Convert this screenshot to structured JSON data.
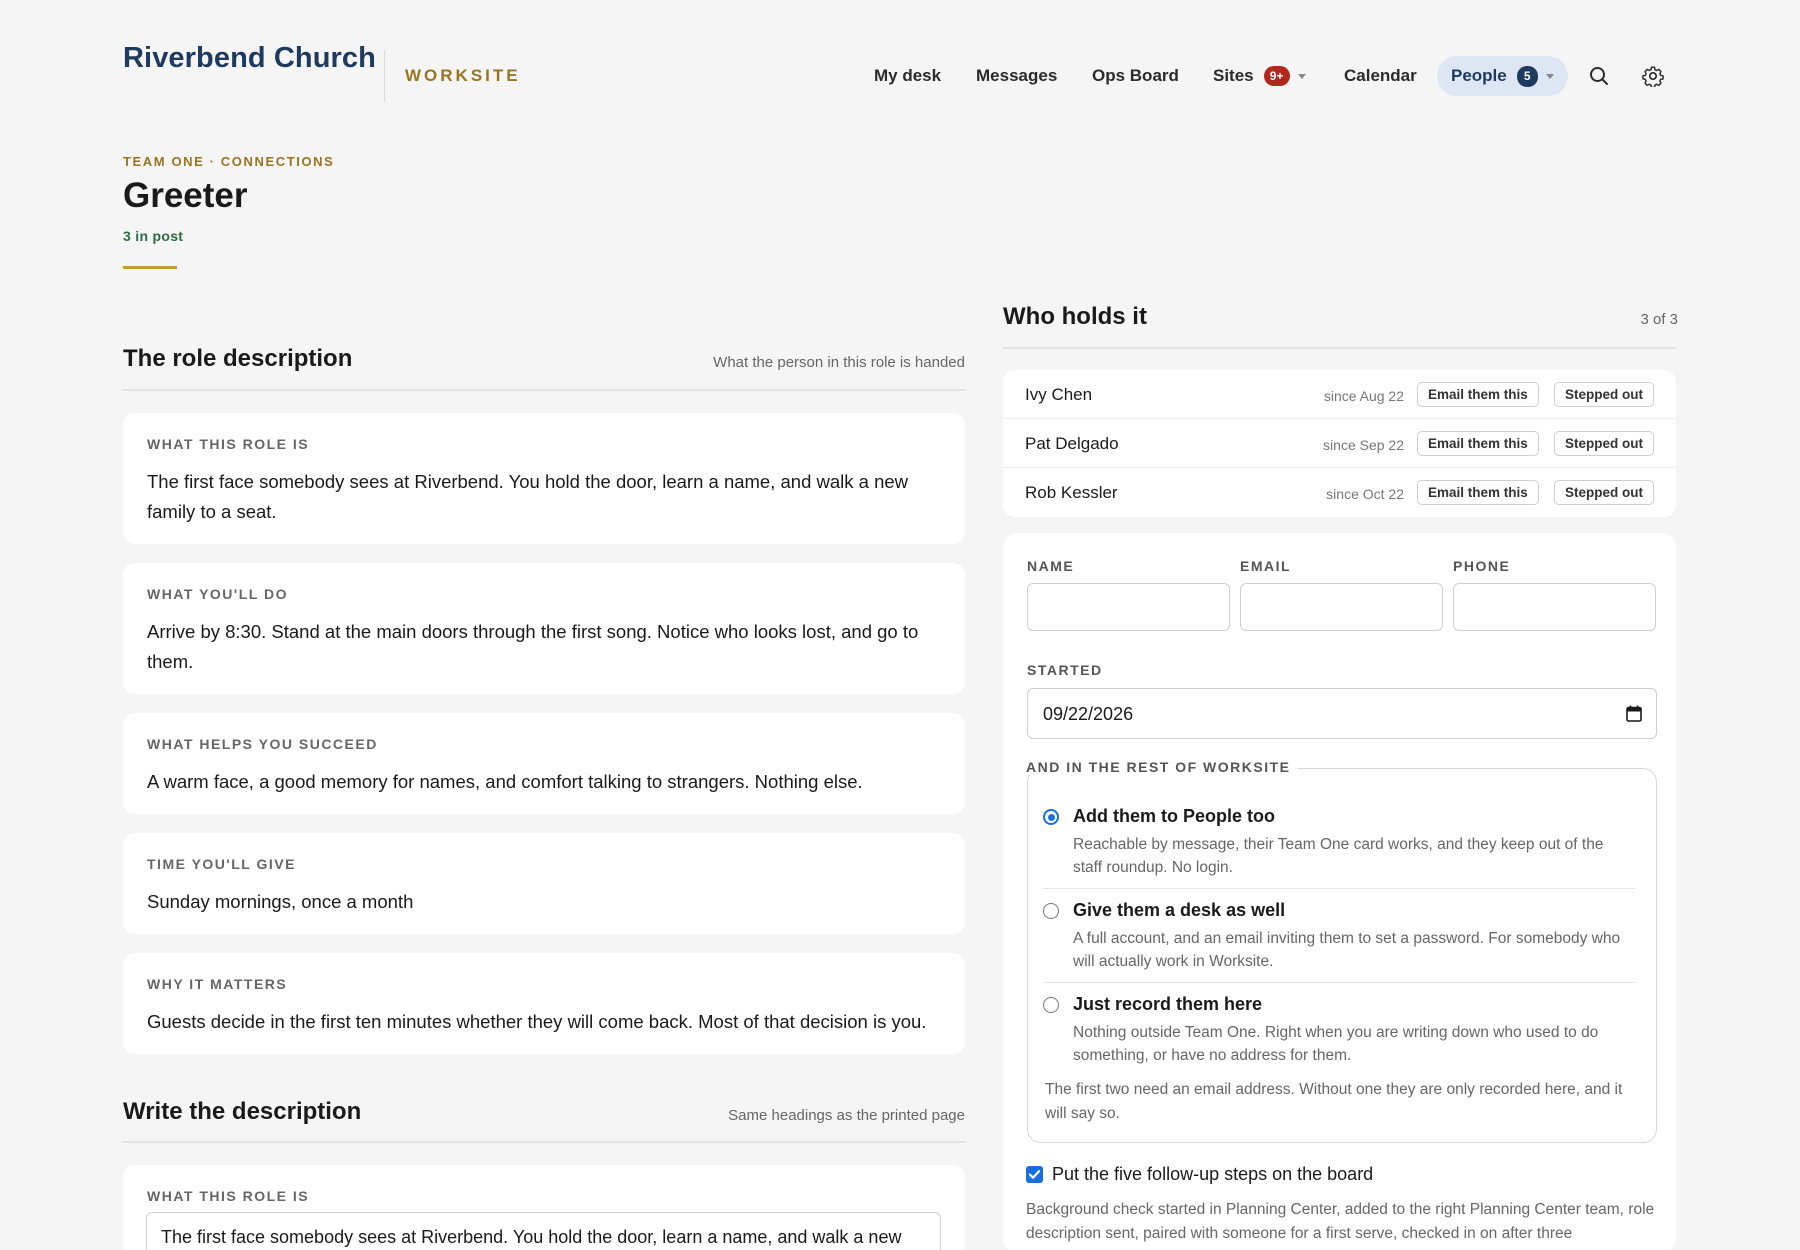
{
  "header": {
    "brand": "Riverbend Church",
    "product": "WORKSITE",
    "nav": [
      {
        "label": "My desk"
      },
      {
        "label": "Messages"
      },
      {
        "label": "Ops Board"
      },
      {
        "label": "Sites",
        "badge": "9+"
      },
      {
        "label": "Calendar"
      },
      {
        "label": "People",
        "badge": "5",
        "active": true
      }
    ],
    "icons": [
      "search-icon",
      "gear-icon"
    ]
  },
  "page": {
    "eyebrow": "TEAM ONE · CONNECTIONS",
    "title": "Greeter",
    "subtitle": "3 in post"
  },
  "role_description": {
    "title": "The role description",
    "note": "What the person in this role is handed",
    "sections": [
      {
        "label": "WHAT THIS ROLE IS",
        "text": "The first face somebody sees at Riverbend. You hold the door, learn a name, and walk a new family to a seat."
      },
      {
        "label": "WHAT YOU'LL DO",
        "text": "Arrive by 8:30. Stand at the main doors through the first song. Notice who looks lost, and go to them."
      },
      {
        "label": "WHAT HELPS YOU SUCCEED",
        "text": "A warm face, a good memory for names, and comfort talking to strangers. Nothing else."
      },
      {
        "label": "TIME YOU'LL GIVE",
        "text": "Sunday mornings, once a month"
      },
      {
        "label": "WHY IT MATTERS",
        "text": "Guests decide in the first ten minutes whether they will come back. Most of that decision is you."
      }
    ]
  },
  "write_description": {
    "title": "Write the description",
    "note": "Same headings as the printed page",
    "field_label": "WHAT THIS ROLE IS",
    "field_value": "The first face somebody sees at Riverbend. You hold the door, learn a name, and walk a new"
  },
  "holders": {
    "title": "Who holds it",
    "count": "3 of 3",
    "rows": [
      {
        "name": "Ivy Chen",
        "since": "since Aug 22",
        "email_label": "Email them this",
        "out_label": "Stepped out"
      },
      {
        "name": "Pat Delgado",
        "since": "since Sep 22",
        "email_label": "Email them this",
        "out_label": "Stepped out"
      },
      {
        "name": "Rob Kessler",
        "since": "since Oct 22",
        "email_label": "Email them this",
        "out_label": "Stepped out"
      }
    ]
  },
  "form": {
    "name_label": "NAME",
    "email_label": "EMAIL",
    "phone_label": "PHONE",
    "name_value": "",
    "email_value": "",
    "phone_value": "",
    "started_label": "STARTED",
    "started_value": "09/22/2026",
    "rest_legend": "AND IN THE REST OF WORKSITE",
    "options": [
      {
        "title": "Add them to People too",
        "desc": "Reachable by message, their Team One card works, and they keep out of the staff roundup. No login.",
        "checked": true
      },
      {
        "title": "Give them a desk as well",
        "desc": "A full account, and an email inviting them to set a password. For somebody who will actually work in Worksite.",
        "checked": false
      },
      {
        "title": "Just record them here",
        "desc": "Nothing outside Team One. Right when you are writing down who used to do something, or have no address for them.",
        "checked": false
      }
    ],
    "rest_note": "The first two need an email address. Without one they are only recorded here, and it will say so.",
    "followup_label": "Put the five follow-up steps on the board",
    "followup_checked": true,
    "followup_note": "Background check started in Planning Center, added to the right Planning Center team, role description sent, paired with someone for a first serve, checked in on after three"
  },
  "colors": {
    "brand": "#1e3a5f",
    "accent_gold": "#9a7420",
    "status_green": "#2e6b3f",
    "badge_red": "#b3261e",
    "radio_blue": "#1a6fe0"
  }
}
